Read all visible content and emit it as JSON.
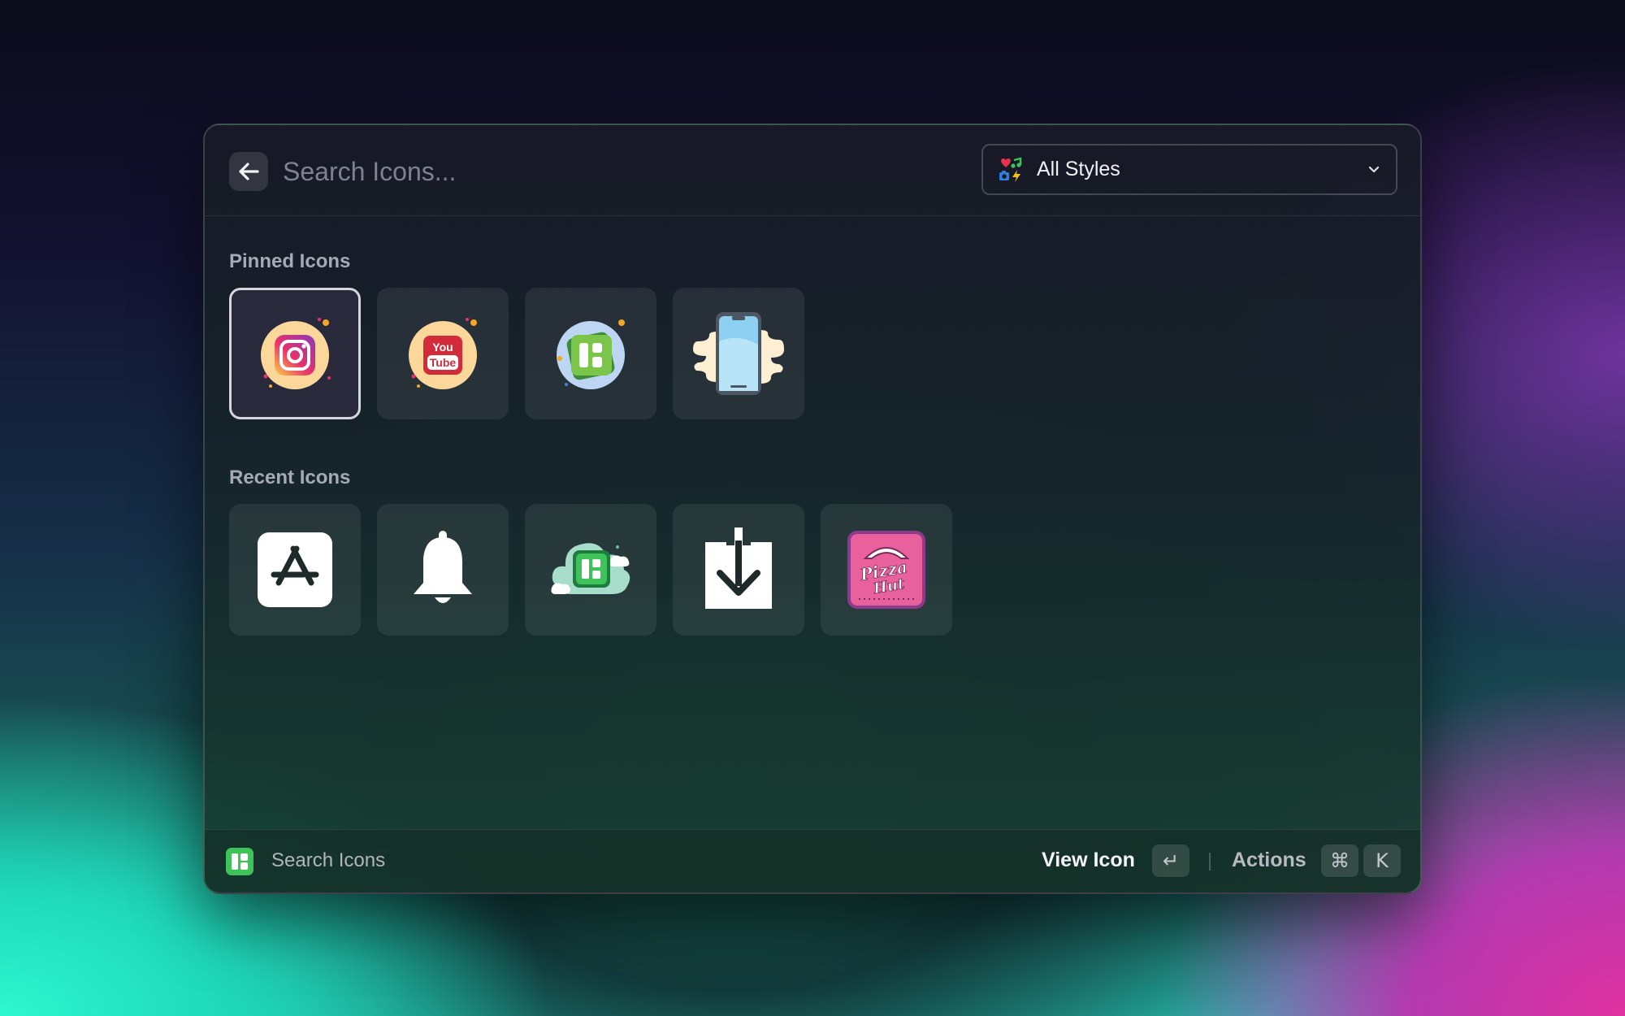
{
  "search": {
    "placeholder": "Search Icons...",
    "back_icon": "arrow-left-icon"
  },
  "style_filter": {
    "selected": "All Styles",
    "icon": "all-styles-icon"
  },
  "pinned": {
    "title": "Pinned Icons",
    "items": [
      {
        "icon": "instagram-icon",
        "selected": true
      },
      {
        "icon": "youtube-icon",
        "selected": false
      },
      {
        "icon": "iconify-app-icon",
        "selected": false
      },
      {
        "icon": "smartphone-icon",
        "selected": false
      }
    ]
  },
  "recent": {
    "title": "Recent Icons",
    "items": [
      {
        "icon": "app-store-icon"
      },
      {
        "icon": "bell-icon"
      },
      {
        "icon": "iconify-cloud-icon"
      },
      {
        "icon": "download-icon"
      },
      {
        "icon": "pizza-hut-icon",
        "logo_text": "Pizza Hut"
      }
    ]
  },
  "footer": {
    "app_title": "Search Icons",
    "primary_action": "View Icon",
    "primary_key": "↵",
    "actions_label": "Actions",
    "actions_keys": [
      "⌘",
      "K"
    ]
  },
  "colors": {
    "accent_green": "#3ec25a",
    "instagram_gradient": [
      "#f9d24a",
      "#e8316a",
      "#8a3ab9"
    ],
    "youtube_red": "#d22b3a",
    "pizza_hut_pink": "#e8609c"
  }
}
